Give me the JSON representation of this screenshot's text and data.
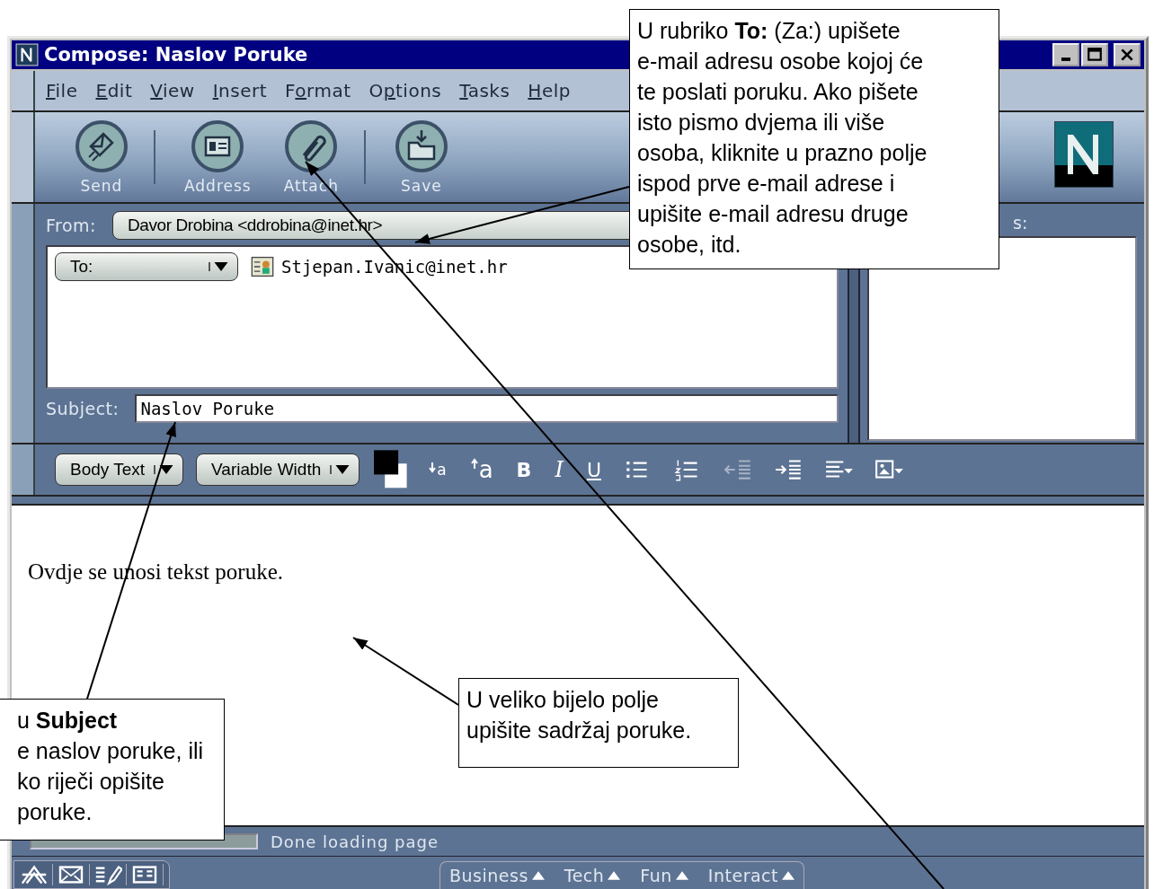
{
  "window": {
    "title": "Compose: Naslov Poruke"
  },
  "menu": [
    {
      "key": "F",
      "post": "ile"
    },
    {
      "key": "E",
      "post": "dit"
    },
    {
      "key": "V",
      "post": "iew"
    },
    {
      "key": "I",
      "post": "nsert"
    },
    {
      "pre": "F",
      "key": "o",
      "post": "rmat"
    },
    {
      "pre": "O",
      "key": "p",
      "post": "tions"
    },
    {
      "key": "T",
      "post": "asks"
    },
    {
      "key": "H",
      "post": "elp"
    }
  ],
  "toolbar": [
    {
      "kind": "send",
      "label": "Send"
    },
    {
      "kind": "address",
      "label": "Address"
    },
    {
      "kind": "attach",
      "label": "Attach"
    },
    {
      "kind": "save",
      "label": "Save"
    }
  ],
  "from": {
    "label": "From:",
    "value": "Davor Drobina <ddrobina@inet.hr>"
  },
  "recipients": [
    {
      "type": "To:",
      "address": "Stjepan.Ivanic@inet.hr"
    }
  ],
  "subject": {
    "label": "Subject:",
    "value": "Naslov Poruke"
  },
  "attachments": {
    "label": "s:"
  },
  "format_bar": {
    "paragraph_style": "Body Text",
    "font": "Variable Width",
    "buttons": [
      {
        "kind": "smaller",
        "label": "a"
      },
      {
        "kind": "larger",
        "label": "a"
      },
      {
        "kind": "bold",
        "label": "B"
      },
      {
        "kind": "italic",
        "label": "I"
      },
      {
        "kind": "underline",
        "label": "U"
      },
      {
        "kind": "bullets"
      },
      {
        "kind": "numbers"
      },
      {
        "kind": "outdent",
        "disabled": true
      },
      {
        "kind": "indent",
        "disabled": false
      },
      {
        "kind": "align"
      },
      {
        "kind": "insert"
      }
    ]
  },
  "body": {
    "text": "Ovdje se unosi tekst poruke."
  },
  "status": {
    "text": "Done loading page",
    "level": 1
  },
  "taskbar": {
    "components": [
      {
        "kind": "navigator"
      },
      {
        "kind": "mail"
      },
      {
        "kind": "composer"
      },
      {
        "kind": "address-book"
      }
    ],
    "tabs": [
      {
        "label": "Business"
      },
      {
        "label": "Tech"
      },
      {
        "label": "Fun"
      },
      {
        "label": "Interact"
      }
    ]
  },
  "callouts": [
    {
      "lines": [
        "U rubriko **To:** (Za:) upišete",
        "e-mail adresu osobe kojoj će",
        "te poslati poruku. Ako pišete",
        "isto pismo dvjema ili više",
        "osoba, kliknite u prazno polje",
        "ispod prve e-mail adrese i",
        "upišite e-mail adresu druge",
        "osobe, itd."
      ]
    },
    {
      "lines": [
        "u **Subject**",
        "e naslov poruke, ili",
        "ko riječi opišite",
        "poruke."
      ]
    },
    {
      "lines": [
        "U veliko bijelo polje",
        "upišite sadržaj poruke."
      ]
    }
  ]
}
